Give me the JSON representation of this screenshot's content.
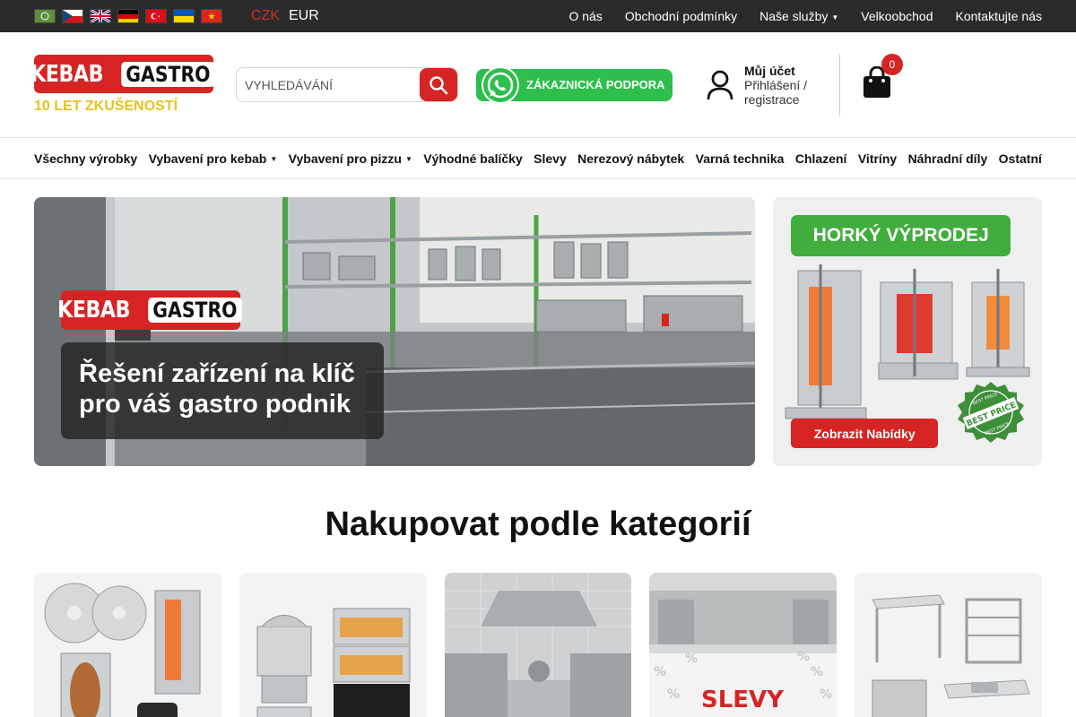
{
  "topbar": {
    "flags": [
      "arabic",
      "czech",
      "english",
      "german",
      "turkish",
      "ukrainian",
      "vietnamese"
    ],
    "currency_active": "CZK",
    "currency_other": "EUR",
    "links": [
      "O nás",
      "Obchodní podmínky",
      "Naše služby",
      "Velkoobchod",
      "Kontaktujte nás"
    ]
  },
  "header": {
    "logo_left": "KEBAB",
    "logo_right": "GASTRO",
    "tagline": "10 LET ZKUŠENOSTÍ",
    "search_placeholder": "VYHLEDÁVÁNÍ",
    "support_label": "ZÁKAZNICKÁ PODPORA",
    "account_title": "Můj účet",
    "account_sub": "Přihlášení / registrace",
    "cart_count": "0"
  },
  "mainnav": [
    "Všechny výrobky",
    "Vybavení pro kebab",
    "Vybavení pro pizzu",
    "Výhodné balíčky",
    "Slevy",
    "Nerezový nábytek",
    "Varná technika",
    "Chlazení",
    "Vitríny",
    "Náhradní díly",
    "Ostatní"
  ],
  "hero": {
    "logo_left": "KEBAB",
    "logo_right": "GASTRO",
    "line1": "Řešení zařízení na klíč",
    "line2": "pro váš gastro podnik"
  },
  "promo": {
    "title": "HORKÝ VÝPRODEJ",
    "button": "Zobrazit Nabídky",
    "badge_top": "BEST PRICE",
    "badge_main": "BEST PRICE",
    "badge_bottom": "BEST PRICE"
  },
  "section_title": "Nakupovat podle kategorií",
  "categories": [
    {
      "label": ""
    },
    {
      "label": ""
    },
    {
      "label": ""
    },
    {
      "label": "SLEVY"
    },
    {
      "label": ""
    }
  ],
  "colors": {
    "brand_red": "#d62424",
    "green": "#40ad3d",
    "yellow": "#e8c21d",
    "dark": "#2b2b2b"
  }
}
